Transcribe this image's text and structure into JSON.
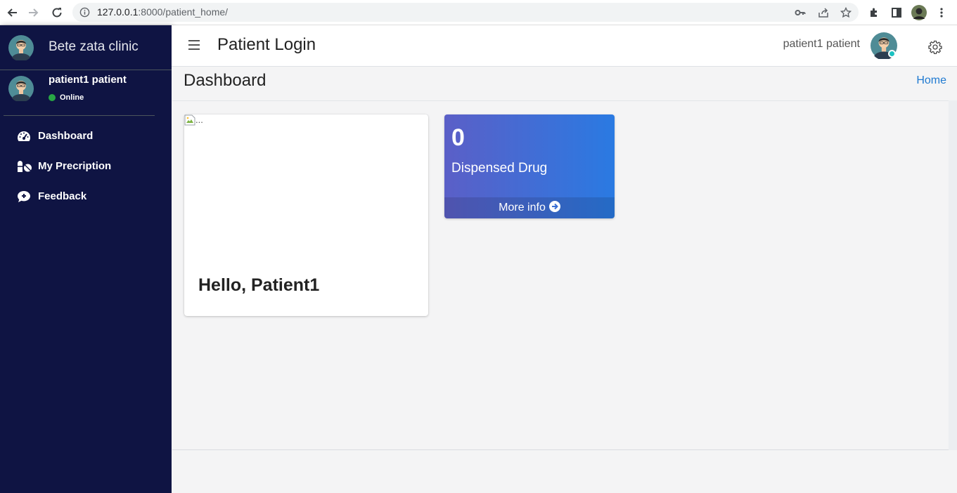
{
  "browser": {
    "url_host": "127.0.0.1",
    "url_port_path": ":8000/patient_home/"
  },
  "sidebar": {
    "brand": "Bete zata clinic",
    "user_name": "patient1 patient",
    "user_status": "Online",
    "items": [
      {
        "label": "Dashboard",
        "icon": "tachometer-icon"
      },
      {
        "label": "My Precription",
        "icon": "pills-icon"
      },
      {
        "label": "Feedback",
        "icon": "comment-plus-icon"
      }
    ]
  },
  "topbar": {
    "title": "Patient Login",
    "user_name": "patient1 patient"
  },
  "content": {
    "title": "Dashboard",
    "breadcrumb": "Home",
    "welcome": {
      "image_alt": "...",
      "greeting": "Hello, Patient1"
    },
    "stat": {
      "value": "0",
      "label": "Dispensed Drug",
      "link": "More info"
    }
  },
  "colors": {
    "sidebar_bg": "#0f1443",
    "stat_gradient_start": "#5b5fc7",
    "stat_gradient_end": "#2a7ae2",
    "link": "#1f7ad1",
    "online": "#28a745"
  }
}
